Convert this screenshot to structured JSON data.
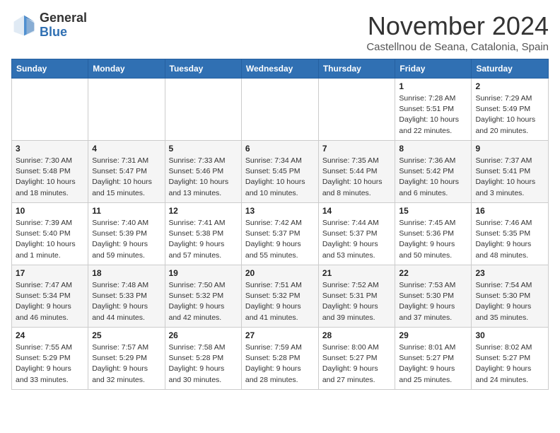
{
  "logo": {
    "general": "General",
    "blue": "Blue"
  },
  "header": {
    "month": "November 2024",
    "location": "Castellnou de Seana, Catalonia, Spain"
  },
  "weekdays": [
    "Sunday",
    "Monday",
    "Tuesday",
    "Wednesday",
    "Thursday",
    "Friday",
    "Saturday"
  ],
  "weeks": [
    [
      {
        "day": "",
        "info": ""
      },
      {
        "day": "",
        "info": ""
      },
      {
        "day": "",
        "info": ""
      },
      {
        "day": "",
        "info": ""
      },
      {
        "day": "",
        "info": ""
      },
      {
        "day": "1",
        "info": "Sunrise: 7:28 AM\nSunset: 5:51 PM\nDaylight: 10 hours and 22 minutes."
      },
      {
        "day": "2",
        "info": "Sunrise: 7:29 AM\nSunset: 5:49 PM\nDaylight: 10 hours and 20 minutes."
      }
    ],
    [
      {
        "day": "3",
        "info": "Sunrise: 7:30 AM\nSunset: 5:48 PM\nDaylight: 10 hours and 18 minutes."
      },
      {
        "day": "4",
        "info": "Sunrise: 7:31 AM\nSunset: 5:47 PM\nDaylight: 10 hours and 15 minutes."
      },
      {
        "day": "5",
        "info": "Sunrise: 7:33 AM\nSunset: 5:46 PM\nDaylight: 10 hours and 13 minutes."
      },
      {
        "day": "6",
        "info": "Sunrise: 7:34 AM\nSunset: 5:45 PM\nDaylight: 10 hours and 10 minutes."
      },
      {
        "day": "7",
        "info": "Sunrise: 7:35 AM\nSunset: 5:44 PM\nDaylight: 10 hours and 8 minutes."
      },
      {
        "day": "8",
        "info": "Sunrise: 7:36 AM\nSunset: 5:42 PM\nDaylight: 10 hours and 6 minutes."
      },
      {
        "day": "9",
        "info": "Sunrise: 7:37 AM\nSunset: 5:41 PM\nDaylight: 10 hours and 3 minutes."
      }
    ],
    [
      {
        "day": "10",
        "info": "Sunrise: 7:39 AM\nSunset: 5:40 PM\nDaylight: 10 hours and 1 minute."
      },
      {
        "day": "11",
        "info": "Sunrise: 7:40 AM\nSunset: 5:39 PM\nDaylight: 9 hours and 59 minutes."
      },
      {
        "day": "12",
        "info": "Sunrise: 7:41 AM\nSunset: 5:38 PM\nDaylight: 9 hours and 57 minutes."
      },
      {
        "day": "13",
        "info": "Sunrise: 7:42 AM\nSunset: 5:37 PM\nDaylight: 9 hours and 55 minutes."
      },
      {
        "day": "14",
        "info": "Sunrise: 7:44 AM\nSunset: 5:37 PM\nDaylight: 9 hours and 53 minutes."
      },
      {
        "day": "15",
        "info": "Sunrise: 7:45 AM\nSunset: 5:36 PM\nDaylight: 9 hours and 50 minutes."
      },
      {
        "day": "16",
        "info": "Sunrise: 7:46 AM\nSunset: 5:35 PM\nDaylight: 9 hours and 48 minutes."
      }
    ],
    [
      {
        "day": "17",
        "info": "Sunrise: 7:47 AM\nSunset: 5:34 PM\nDaylight: 9 hours and 46 minutes."
      },
      {
        "day": "18",
        "info": "Sunrise: 7:48 AM\nSunset: 5:33 PM\nDaylight: 9 hours and 44 minutes."
      },
      {
        "day": "19",
        "info": "Sunrise: 7:50 AM\nSunset: 5:32 PM\nDaylight: 9 hours and 42 minutes."
      },
      {
        "day": "20",
        "info": "Sunrise: 7:51 AM\nSunset: 5:32 PM\nDaylight: 9 hours and 41 minutes."
      },
      {
        "day": "21",
        "info": "Sunrise: 7:52 AM\nSunset: 5:31 PM\nDaylight: 9 hours and 39 minutes."
      },
      {
        "day": "22",
        "info": "Sunrise: 7:53 AM\nSunset: 5:30 PM\nDaylight: 9 hours and 37 minutes."
      },
      {
        "day": "23",
        "info": "Sunrise: 7:54 AM\nSunset: 5:30 PM\nDaylight: 9 hours and 35 minutes."
      }
    ],
    [
      {
        "day": "24",
        "info": "Sunrise: 7:55 AM\nSunset: 5:29 PM\nDaylight: 9 hours and 33 minutes."
      },
      {
        "day": "25",
        "info": "Sunrise: 7:57 AM\nSunset: 5:29 PM\nDaylight: 9 hours and 32 minutes."
      },
      {
        "day": "26",
        "info": "Sunrise: 7:58 AM\nSunset: 5:28 PM\nDaylight: 9 hours and 30 minutes."
      },
      {
        "day": "27",
        "info": "Sunrise: 7:59 AM\nSunset: 5:28 PM\nDaylight: 9 hours and 28 minutes."
      },
      {
        "day": "28",
        "info": "Sunrise: 8:00 AM\nSunset: 5:27 PM\nDaylight: 9 hours and 27 minutes."
      },
      {
        "day": "29",
        "info": "Sunrise: 8:01 AM\nSunset: 5:27 PM\nDaylight: 9 hours and 25 minutes."
      },
      {
        "day": "30",
        "info": "Sunrise: 8:02 AM\nSunset: 5:27 PM\nDaylight: 9 hours and 24 minutes."
      }
    ]
  ]
}
